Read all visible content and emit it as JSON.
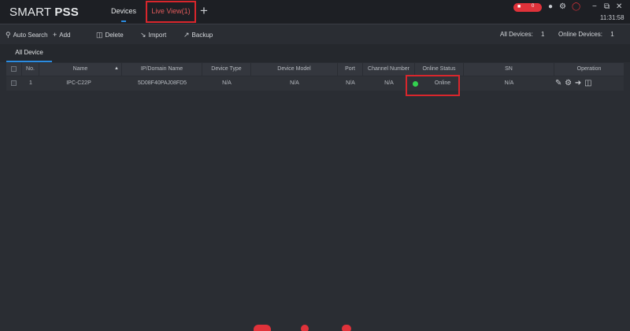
{
  "app": {
    "logo_light": "SMART ",
    "logo_bold": "PSS",
    "tabs": [
      {
        "label": "Devices"
      },
      {
        "label": "Live View(1)"
      }
    ],
    "add_tab_glyph": "+",
    "alarm_count": "0",
    "clock": "11:31:58"
  },
  "toolbar": {
    "auto_search": "Auto Search",
    "add": "Add",
    "delete": "Delete",
    "import": "Import",
    "backup": "Backup",
    "all_devices_label": "All Devices:",
    "all_devices_count": "1",
    "online_devices_label": "Online Devices:",
    "online_devices_count": "1"
  },
  "subtab": {
    "label": "All Device"
  },
  "table": {
    "columns": [
      "No.",
      "Name",
      "IP/Domain Name",
      "Device Type",
      "Device Model",
      "Port",
      "Channel Number",
      "Online Status",
      "SN",
      "Operation"
    ],
    "rows": [
      {
        "no": "1",
        "name": "IPC-C22P",
        "ip": "5D08F40PAJ08FD5",
        "type": "N/A",
        "model": "N/A",
        "port": "N/A",
        "channel": "N/A",
        "status": "Online",
        "sn": "N/A"
      }
    ]
  },
  "colors": {
    "accent": "#2b8be0",
    "highlight_red": "#d9262c",
    "online_green": "#33d14f",
    "background": "#2a2d33"
  },
  "icons": {
    "toolbar": [
      "search-icon",
      "plus-icon",
      "trash-icon",
      "import-icon",
      "backup-icon"
    ],
    "titlebar": [
      "speaker-icon",
      "user-icon",
      "gear-icon",
      "lock-icon",
      "minimize-icon",
      "restore-icon",
      "close-icon"
    ],
    "operation": [
      "edit-icon",
      "settings-icon",
      "logout-icon",
      "trash-icon"
    ]
  }
}
